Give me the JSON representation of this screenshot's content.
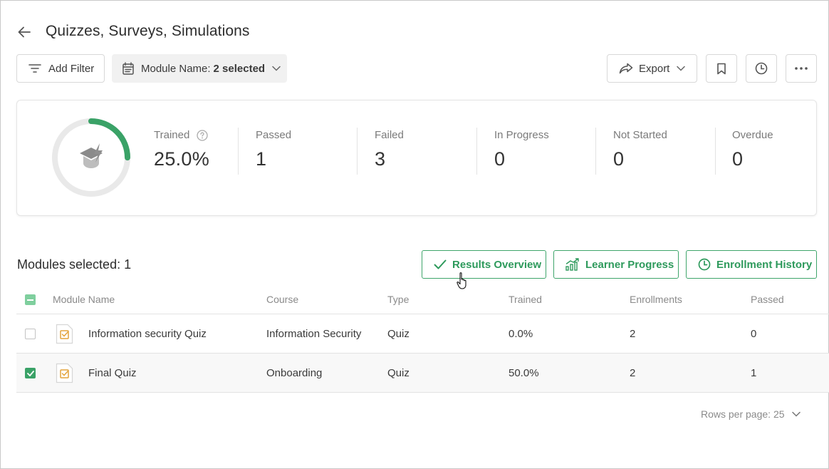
{
  "header": {
    "title": "Quizzes, Surveys, Simulations",
    "back_icon": "arrow-left-icon"
  },
  "toolbar": {
    "add_filter_label": "Add Filter",
    "module_filter_label": "Module Name:",
    "module_filter_value": "2 selected",
    "export_label": "Export"
  },
  "stats": {
    "progress_fraction": 0.25,
    "accent_color": "#3aa267",
    "items": [
      {
        "label": "Trained",
        "value": "25.0%"
      },
      {
        "label": "Passed",
        "value": "1"
      },
      {
        "label": "Failed",
        "value": "3"
      },
      {
        "label": "In Progress",
        "value": "0"
      },
      {
        "label": "Not Started",
        "value": "0"
      },
      {
        "label": "Overdue",
        "value": "0"
      }
    ]
  },
  "selection": {
    "text": "Modules selected: 1"
  },
  "actions": {
    "results_overview": "Results Overview",
    "learner_progress": "Learner Progress",
    "enrollment_history": "Enrollment History"
  },
  "table": {
    "columns": [
      "Module Name",
      "Course",
      "Type",
      "Trained",
      "Enrollments",
      "Passed"
    ],
    "rows": [
      {
        "name": "Information security Quiz",
        "course": "Information Security",
        "type": "Quiz",
        "trained": "0.0%",
        "enrollments": "2",
        "passed": "0",
        "checked": false
      },
      {
        "name": "Final Quiz",
        "course": "Onboarding",
        "type": "Quiz",
        "trained": "50.0%",
        "enrollments": "2",
        "passed": "1",
        "checked": true
      }
    ]
  },
  "pagination": {
    "rows_per_page": "Rows per page: 25"
  }
}
